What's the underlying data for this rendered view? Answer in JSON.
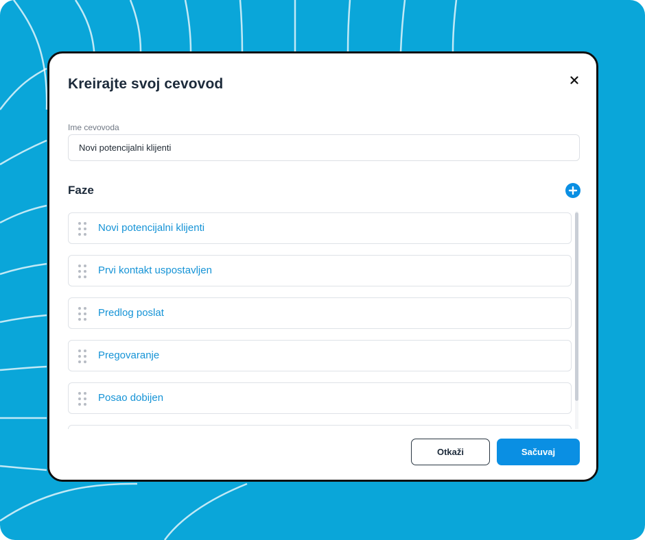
{
  "modal": {
    "title": "Kreirajte svoj cevovod",
    "close_icon": "close-icon"
  },
  "pipeline_name": {
    "label": "Ime cevovoda",
    "value": "Novi potencijalni klijenti"
  },
  "stages": {
    "title": "Faze",
    "add_icon": "plus-circle-icon",
    "drag_icon": "drag-handle-icon",
    "items": [
      {
        "label": "Novi potencijalni klijenti"
      },
      {
        "label": "Prvi kontakt uspostavljen"
      },
      {
        "label": "Predlog poslat"
      },
      {
        "label": "Pregovaranje"
      },
      {
        "label": "Posao dobijen"
      },
      {
        "label": ""
      }
    ]
  },
  "footer": {
    "cancel_label": "Otkaži",
    "save_label": "Sačuvaj"
  },
  "colors": {
    "background": "#0aa6d9",
    "accent": "#0a8fe3",
    "stage_text": "#1593d6",
    "title_text": "#1c2a3a"
  }
}
